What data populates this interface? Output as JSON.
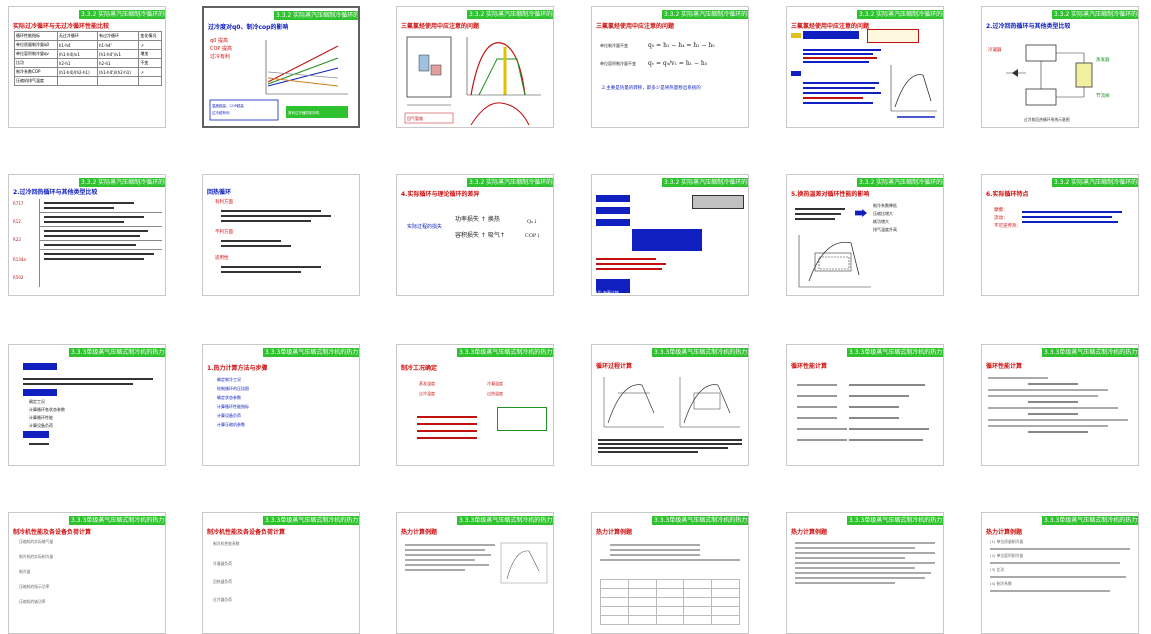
{
  "slides": [
    {
      "index": 1,
      "header": "3.3.2 实际蒸汽压缩制冷循环的影响",
      "title": "实际过冷循环与无过冷循环性能比较"
    },
    {
      "index": 2,
      "header": "3.3.2 实际蒸汽压缩制冷循环的影响",
      "title": "过冷度对q0、制冷cop的影响"
    },
    {
      "index": 3,
      "header": "3.3.2 实际蒸汽压缩制冷循环的影响",
      "title": "三氟氯烃使用中应注意的问题"
    },
    {
      "index": 4,
      "header": "3.3.2 实际蒸汽压缩制冷循环的影响",
      "title": "三氟氯烃使用中应注意的问题"
    },
    {
      "index": 5,
      "header": "3.3.2 实际蒸汽压缩制冷循环的影响",
      "title": "三氟氯烃使用中应注意的问题"
    },
    {
      "index": 6,
      "header": "3.3.2 实际蒸汽压缩制冷循环的影响",
      "title": "2.过冷回热循环与其他类型比较"
    },
    {
      "index": 7,
      "header": "3.3.2 实际蒸汽压缩制冷循环的影响",
      "title": "2.过冷回热循环与其他类型比较"
    },
    {
      "index": 8,
      "header": "3.3.2 实际蒸汽压缩制冷循环的影响",
      "title": "回热循环"
    },
    {
      "index": 9,
      "header": "3.3.2 实际蒸汽压缩制冷循环的影响",
      "title": "4.实际循环与理论循环的差异"
    },
    {
      "index": 10,
      "header": "3.3.2 实际蒸汽压缩制冷循环的影响",
      "title": "(1) 吸气过热"
    },
    {
      "index": 11,
      "header": "3.3.2 实际蒸汽压缩制冷循环的影响",
      "title": "5.换热温差对循环性能的影响"
    },
    {
      "index": 12,
      "header": "3.3.2 实际蒸汽压缩制冷循环的影响",
      "title": "6.实际循环特点"
    },
    {
      "index": 13,
      "header": "3.3.3单级蒸气压缩式制冷机的热力计算",
      "title": "热力计算目的"
    },
    {
      "index": 14,
      "header": "3.3.3单级蒸气压缩式制冷机的热力计算",
      "title": "1.热力计算方法与步骤"
    },
    {
      "index": 15,
      "header": "3.3.3单级蒸气压缩式制冷机的热力计算",
      "title": "制冷工况确定"
    },
    {
      "index": 16,
      "header": "3.3.3单级蒸气压缩式制冷机的热力计算",
      "title": "循环过程计算"
    },
    {
      "index": 17,
      "header": "3.3.3单级蒸气压缩式制冷机的热力计算",
      "title": "循环性能计算"
    },
    {
      "index": 18,
      "header": "3.3.3单级蒸气压缩式制冷机的热力计算",
      "title": "循环性能计算"
    },
    {
      "index": 19,
      "header": "3.3.3单级蒸气压缩式制冷机的热力计算",
      "title": "制冷机性能及各设备负荷计算"
    },
    {
      "index": 20,
      "header": "3.3.3单级蒸气压缩式制冷机的热力计算",
      "title": "制冷机性能及各设备负荷计算"
    },
    {
      "index": 21,
      "header": "3.3.3单级蒸气压缩式制冷机的热力计算",
      "title": "热力计算例题"
    },
    {
      "index": 22,
      "header": "3.3.3单级蒸气压缩式制冷机的热力计算",
      "title": "热力计算例题"
    },
    {
      "index": 23,
      "header": "3.3.3单级蒸气压缩式制冷机的热力计算",
      "title": "热力计算例题"
    },
    {
      "index": 24,
      "header": "3.3.3单级蒸气压缩式制冷机的热力计算",
      "title": "热力计算例题"
    }
  ],
  "s1": {
    "headers": [
      "循环性能指标",
      "无过冷循环",
      "有过冷循环",
      "变化情况"
    ],
    "rows": [
      [
        "单位质量制冷量q0",
        "h1-h4",
        "h1-h4'",
        "↗"
      ],
      [
        "单位容积制冷量qv",
        "(h1-h4)/v1",
        "(h1-h4')/v1",
        "增加"
      ],
      [
        "比功",
        "h2-h1",
        "h2-h1",
        "不变"
      ],
      [
        "制冷系数COP",
        "(h1-h4)/(h2-h1)",
        "(h1-h4')/(h2-h1)",
        "↗"
      ],
      [
        "压缩机排气温度",
        "",
        "",
        ""
      ]
    ]
  },
  "s2": {
    "note1": "温度越高，COP越高，过冷越有利",
    "note2": "制冷量增加，说明过冷提高了循环性能",
    "note3": "具有过冷器的制冷机"
  },
  "s3": {
    "label": "回气管路"
  },
  "s4": {
    "line1": "单位制冷量不变",
    "line2": "单位容积制冷量不变",
    "line3": "2.主要是热量的转移，即多少是将热量移出系统的"
  },
  "s6": {
    "label1": "冷凝器",
    "label2": "蒸发器",
    "label3": "节流阀",
    "caption": "过冷和回热循环系统示意图"
  },
  "s7": {
    "rows": [
      "R717",
      "R12",
      "R22",
      "R134a",
      "R502"
    ]
  },
  "s8": {
    "heading": "回热循环",
    "bullet1": "有利方面",
    "bullet2": "不利方面",
    "bullet3": "适用性"
  },
  "s9": {
    "label": "实际过程的损失"
  },
  "s10": {
    "items": [
      "(1) 吸气过热",
      "(2) 有效过热",
      "(3) 无效过热",
      "(4) 有害过热"
    ]
  },
  "s11": {
    "items": [
      "制冷系数降低",
      "压缩比增大",
      "耗功增大",
      "排气温度升高"
    ]
  },
  "s12": {
    "items": [
      "摩擦：",
      "流动：",
      "不可逆传热："
    ]
  },
  "s13": {
    "items": [
      "确定工况",
      "计算循环各状态参数",
      "计算循环性能",
      "计算设备负荷"
    ],
    "label": "主要方法"
  },
  "s14": {
    "items": [
      "确定制冷工况",
      "绘制循环的压焓图",
      "确定状态参数",
      "计算循环性能指标",
      "计算设备负荷",
      "计算压缩机参数"
    ]
  },
  "s15": {
    "label1": "蒸发温度",
    "label2": "冷凝温度",
    "label3": "过冷温度",
    "label4": "过热温度"
  },
  "s19": {
    "items": [
      "压缩机的实际输气量",
      "制冷机的实际制冷量",
      "制冷量",
      "压缩机的指示功率",
      "压缩机的轴功率"
    ]
  },
  "s20": {
    "items": [
      "制冷机性能系数",
      "冷凝器负荷",
      "回热器负荷",
      "过冷器负荷"
    ]
  },
  "s23": {
    "label": "热力计算例题"
  },
  "s24": {
    "items": [
      "(1) 单位质量制冷量",
      "(2) 单位容积制冷量",
      "(3) 比功",
      "(4) 制冷系数"
    ]
  }
}
